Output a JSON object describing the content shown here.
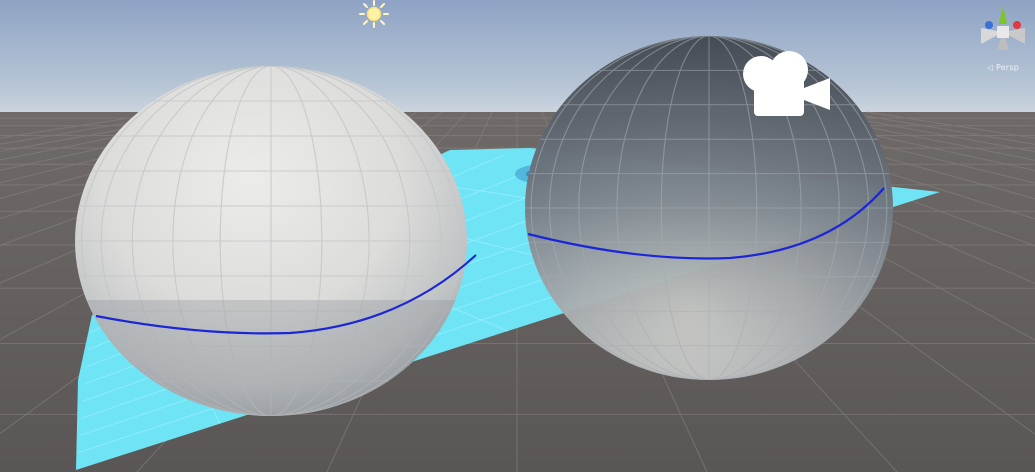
{
  "scene": {
    "sky_top_color": "#8ea3c4",
    "sky_horizon_color": "#c7d2dc",
    "ground_color": "#5d5958",
    "plane_color": "#6ee4f5",
    "sphere_opaque_color": "#dedede",
    "sphere_transparent_color": "#7c8590",
    "curve_color": "#1b26d6",
    "objects": [
      {
        "kind": "directional-light-gizmo",
        "icon": "sun-icon"
      },
      {
        "kind": "camera-gizmo",
        "icon": "camera-icon"
      },
      {
        "kind": "plane"
      },
      {
        "kind": "sphere-opaque"
      },
      {
        "kind": "sphere-transparent"
      }
    ]
  },
  "gizmo": {
    "projection_label": "◁ Persp",
    "axis_colors": {
      "x": "#e0383d",
      "y": "#7cc622",
      "z": "#3a6fd6"
    }
  }
}
